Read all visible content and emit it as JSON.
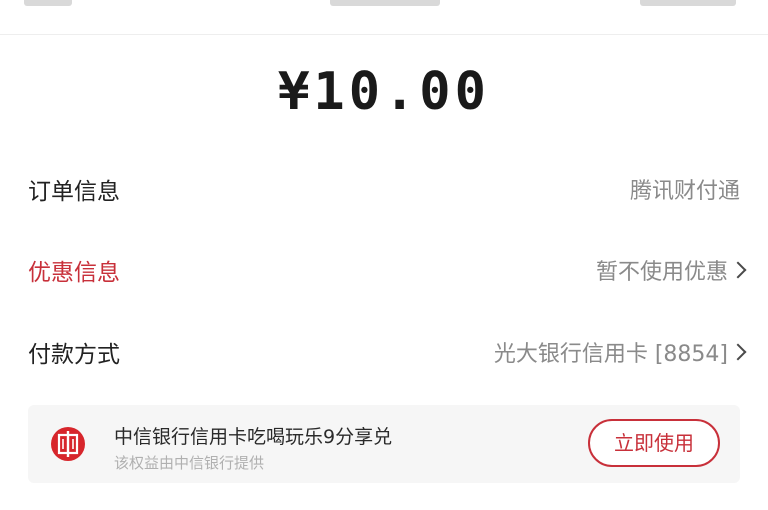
{
  "amount": "¥10.00",
  "rows": [
    {
      "label": "订单信息",
      "value": "腾讯财付通",
      "has_arrow": false
    },
    {
      "label": "优惠信息",
      "value": "暂不使用优惠",
      "has_arrow": true
    },
    {
      "label": "付款方式",
      "value": "光大银行信用卡 [8854]",
      "has_arrow": true
    }
  ],
  "promo": {
    "logo_icon": "citic-bank-logo-icon",
    "title": "中信银行信用卡吃喝玩乐9分享兑",
    "subtitle": "该权益由中信银行提供",
    "button_label": "立即使用"
  },
  "colors": {
    "accent_red": "#c8303a",
    "text_dark": "#222222",
    "text_muted": "#8a8a8a",
    "promo_bg": "#f6f6f6"
  }
}
